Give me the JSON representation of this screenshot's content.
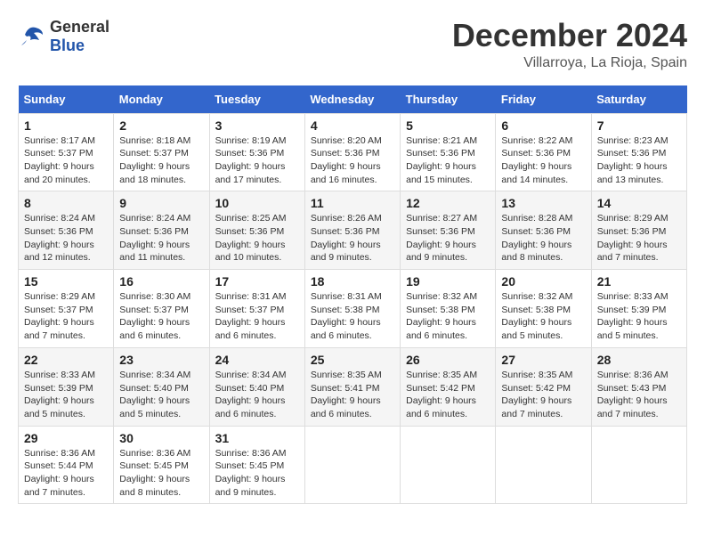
{
  "logo": {
    "text_general": "General",
    "text_blue": "Blue"
  },
  "header": {
    "month": "December 2024",
    "location": "Villarroya, La Rioja, Spain"
  },
  "weekdays": [
    "Sunday",
    "Monday",
    "Tuesday",
    "Wednesday",
    "Thursday",
    "Friday",
    "Saturday"
  ],
  "weeks": [
    [
      {
        "day": "1",
        "sunrise": "8:17 AM",
        "sunset": "5:37 PM",
        "daylight": "9 hours and 20 minutes."
      },
      {
        "day": "2",
        "sunrise": "8:18 AM",
        "sunset": "5:37 PM",
        "daylight": "9 hours and 18 minutes."
      },
      {
        "day": "3",
        "sunrise": "8:19 AM",
        "sunset": "5:36 PM",
        "daylight": "9 hours and 17 minutes."
      },
      {
        "day": "4",
        "sunrise": "8:20 AM",
        "sunset": "5:36 PM",
        "daylight": "9 hours and 16 minutes."
      },
      {
        "day": "5",
        "sunrise": "8:21 AM",
        "sunset": "5:36 PM",
        "daylight": "9 hours and 15 minutes."
      },
      {
        "day": "6",
        "sunrise": "8:22 AM",
        "sunset": "5:36 PM",
        "daylight": "9 hours and 14 minutes."
      },
      {
        "day": "7",
        "sunrise": "8:23 AM",
        "sunset": "5:36 PM",
        "daylight": "9 hours and 13 minutes."
      }
    ],
    [
      {
        "day": "8",
        "sunrise": "8:24 AM",
        "sunset": "5:36 PM",
        "daylight": "9 hours and 12 minutes."
      },
      {
        "day": "9",
        "sunrise": "8:24 AM",
        "sunset": "5:36 PM",
        "daylight": "9 hours and 11 minutes."
      },
      {
        "day": "10",
        "sunrise": "8:25 AM",
        "sunset": "5:36 PM",
        "daylight": "9 hours and 10 minutes."
      },
      {
        "day": "11",
        "sunrise": "8:26 AM",
        "sunset": "5:36 PM",
        "daylight": "9 hours and 9 minutes."
      },
      {
        "day": "12",
        "sunrise": "8:27 AM",
        "sunset": "5:36 PM",
        "daylight": "9 hours and 9 minutes."
      },
      {
        "day": "13",
        "sunrise": "8:28 AM",
        "sunset": "5:36 PM",
        "daylight": "9 hours and 8 minutes."
      },
      {
        "day": "14",
        "sunrise": "8:29 AM",
        "sunset": "5:36 PM",
        "daylight": "9 hours and 7 minutes."
      }
    ],
    [
      {
        "day": "15",
        "sunrise": "8:29 AM",
        "sunset": "5:37 PM",
        "daylight": "9 hours and 7 minutes."
      },
      {
        "day": "16",
        "sunrise": "8:30 AM",
        "sunset": "5:37 PM",
        "daylight": "9 hours and 6 minutes."
      },
      {
        "day": "17",
        "sunrise": "8:31 AM",
        "sunset": "5:37 PM",
        "daylight": "9 hours and 6 minutes."
      },
      {
        "day": "18",
        "sunrise": "8:31 AM",
        "sunset": "5:38 PM",
        "daylight": "9 hours and 6 minutes."
      },
      {
        "day": "19",
        "sunrise": "8:32 AM",
        "sunset": "5:38 PM",
        "daylight": "9 hours and 6 minutes."
      },
      {
        "day": "20",
        "sunrise": "8:32 AM",
        "sunset": "5:38 PM",
        "daylight": "9 hours and 5 minutes."
      },
      {
        "day": "21",
        "sunrise": "8:33 AM",
        "sunset": "5:39 PM",
        "daylight": "9 hours and 5 minutes."
      }
    ],
    [
      {
        "day": "22",
        "sunrise": "8:33 AM",
        "sunset": "5:39 PM",
        "daylight": "9 hours and 5 minutes."
      },
      {
        "day": "23",
        "sunrise": "8:34 AM",
        "sunset": "5:40 PM",
        "daylight": "9 hours and 5 minutes."
      },
      {
        "day": "24",
        "sunrise": "8:34 AM",
        "sunset": "5:40 PM",
        "daylight": "9 hours and 6 minutes."
      },
      {
        "day": "25",
        "sunrise": "8:35 AM",
        "sunset": "5:41 PM",
        "daylight": "9 hours and 6 minutes."
      },
      {
        "day": "26",
        "sunrise": "8:35 AM",
        "sunset": "5:42 PM",
        "daylight": "9 hours and 6 minutes."
      },
      {
        "day": "27",
        "sunrise": "8:35 AM",
        "sunset": "5:42 PM",
        "daylight": "9 hours and 7 minutes."
      },
      {
        "day": "28",
        "sunrise": "8:36 AM",
        "sunset": "5:43 PM",
        "daylight": "9 hours and 7 minutes."
      }
    ],
    [
      {
        "day": "29",
        "sunrise": "8:36 AM",
        "sunset": "5:44 PM",
        "daylight": "9 hours and 7 minutes."
      },
      {
        "day": "30",
        "sunrise": "8:36 AM",
        "sunset": "5:45 PM",
        "daylight": "9 hours and 8 minutes."
      },
      {
        "day": "31",
        "sunrise": "8:36 AM",
        "sunset": "5:45 PM",
        "daylight": "9 hours and 9 minutes."
      },
      null,
      null,
      null,
      null
    ]
  ],
  "labels": {
    "sunrise": "Sunrise:",
    "sunset": "Sunset:",
    "daylight": "Daylight:"
  }
}
